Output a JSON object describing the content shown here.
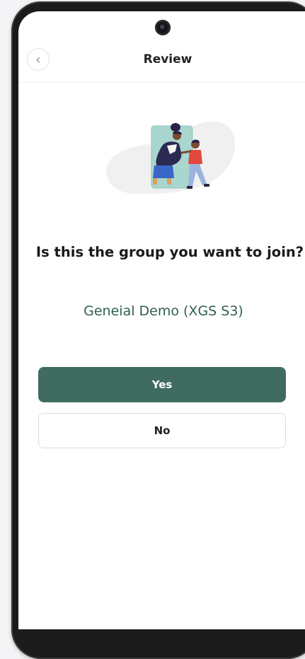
{
  "header": {
    "title": "Review",
    "back_icon": "chevron-left-icon"
  },
  "illustration": {
    "description_icon": "parent-child-illustration-icon"
  },
  "prompt": {
    "question": "Is this the group you want to join?",
    "group_name": "Geneial Demo (XGS S3)"
  },
  "actions": {
    "yes_label": "Yes",
    "no_label": "No"
  },
  "colors": {
    "primary": "#3f6b61",
    "group_text": "#2f5f55",
    "background": "#ffffff"
  }
}
